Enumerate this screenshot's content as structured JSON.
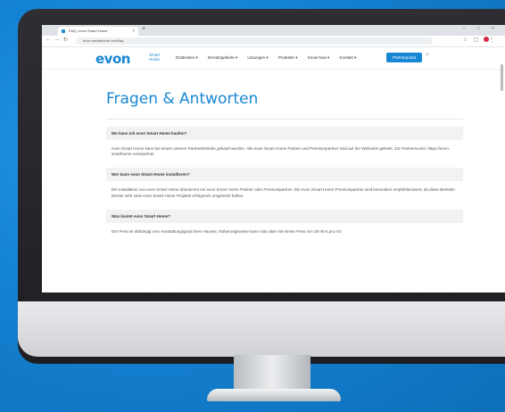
{
  "browser": {
    "tab_title": "FAQ | evon Smart Home",
    "tab_close": "×",
    "tab_add": "+",
    "window_controls": "– □ ×",
    "url": "evon-smarthome.com/faq",
    "nav_icons": [
      "back-icon",
      "forward-icon",
      "reload-icon"
    ]
  },
  "site": {
    "logo": "evon",
    "logo_sub_1": "Smart",
    "logo_sub_2": "Home",
    "menu": [
      "Entdecken ▾",
      "Einsatzgebiete ▾",
      "Lösungen ▾",
      "Produkte ▾",
      "Know-how ▾",
      "Kontakt ▾"
    ],
    "portal_button": "Partnerportal"
  },
  "faq": {
    "title": "Fragen & Antworten",
    "items": [
      {
        "question": "Wo kann ich evon Smart Home kaufen?",
        "answer": "evon Smart Home kann bei einem unserer Partnerbetriebe gekauft werden. Alle evon Smart Home Partner und Premiumpartner sind auf der Webseite gelistet. Zur Partnersuche: https://evon-smarthome.com/partner"
      },
      {
        "question": "Wer kann evon Smart Home installieren?",
        "answer": "Die Installation von evon Smart Home übernimmt ein evon Smart Home Partner oder Premiumpartner. Die evon Smart Home Premiumpartner sind besonders empfehlenswert, da diese Betriebe bereits sehr viele evon Smart Home Projekte erfolgreich umgesetzt haben."
      },
      {
        "question": "Was kostet evon Smart Home?",
        "answer": "Der Preis ist abhängig vom Ausstattungsgrad Ihres Hauses. Näherungsweise kann man aber mit einem Preis von 20-45 € pro m2"
      }
    ]
  }
}
